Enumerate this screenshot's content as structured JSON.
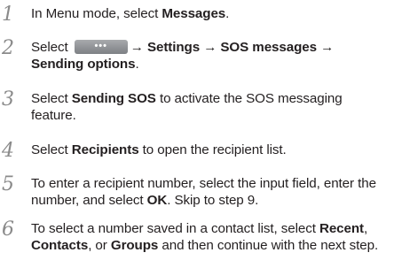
{
  "steps": [
    {
      "number": "1",
      "parts": [
        "In Menu mode, select ",
        "Messages",
        "."
      ]
    },
    {
      "number": "2",
      "parts": [
        "Select ",
        "→ ",
        "Settings",
        " → ",
        "SOS messages",
        " → ",
        "Sending options",
        "."
      ],
      "menu_icon_glyph": "•••"
    },
    {
      "number": "3",
      "parts": [
        "Select ",
        "Sending SOS",
        " to activate the SOS messaging feature."
      ]
    },
    {
      "number": "4",
      "parts": [
        "Select ",
        "Recipients",
        " to open the recipient list."
      ]
    },
    {
      "number": "5",
      "parts": [
        "To enter a recipient number, select the input field, enter the number, and select ",
        "OK",
        ". Skip to step 9."
      ]
    },
    {
      "number": "6",
      "parts": [
        "To select a number saved in a contact list, select ",
        "Recent",
        ", ",
        "Contacts",
        ", or ",
        "Groups",
        " and then continue with the next step."
      ]
    }
  ]
}
